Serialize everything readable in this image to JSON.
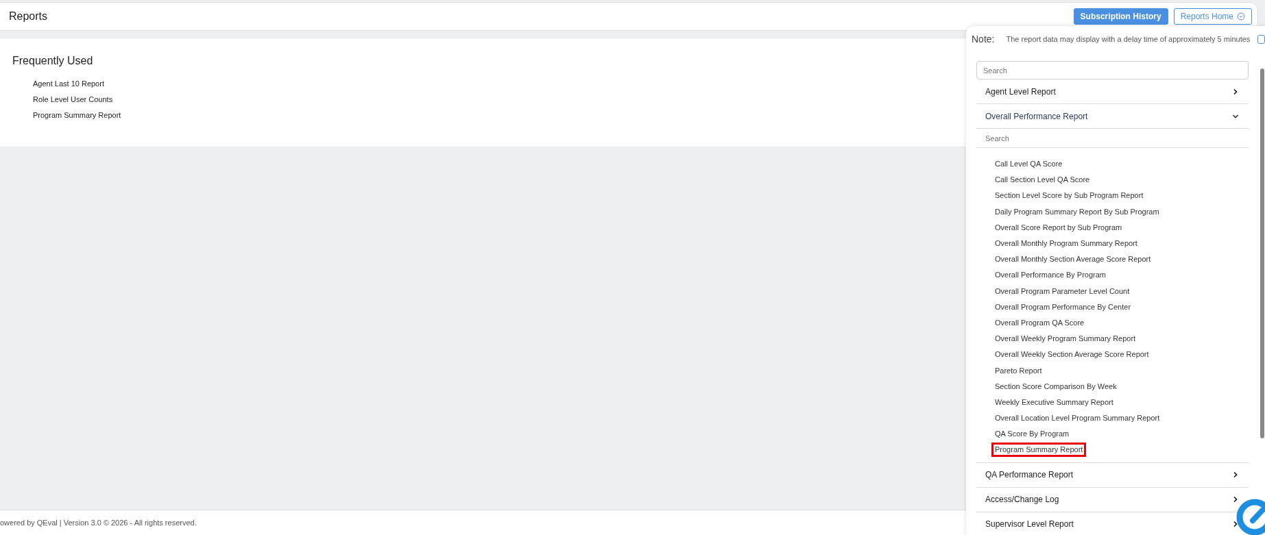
{
  "header": {
    "title": "Reports",
    "buttons": [
      {
        "label": "Subscription History",
        "kind": "primary"
      },
      {
        "label": "Reports Home",
        "kind": "outline"
      }
    ]
  },
  "frequently_used": {
    "title": "Frequently Used",
    "items": [
      "Agent Last 10 Report",
      "Role Level User Counts",
      "Program Summary Report"
    ]
  },
  "panel": {
    "note_label": "Note:",
    "note": "The report data may display with a delay time of approximately 5 minutes",
    "search": {
      "placeholder": "Search"
    },
    "categories": [
      {
        "label": "Agent Level Report",
        "expanded": false
      },
      {
        "label": "Overall Performance Report",
        "expanded": true,
        "search": {
          "placeholder": "Search"
        },
        "items": [
          {
            "label": "Call Level QA Score",
            "highlighted": false
          },
          {
            "label": "Call Section Level QA Score",
            "highlighted": false
          },
          {
            "label": "Section Level Score by Sub Program Report",
            "highlighted": false
          },
          {
            "label": "Daily Program Summary Report By Sub Program",
            "highlighted": false
          },
          {
            "label": "Overall Score Report by Sub Program",
            "highlighted": false
          },
          {
            "label": "Overall Monthly Program Summary Report",
            "highlighted": false
          },
          {
            "label": "Overall Monthly Section Average Score Report",
            "highlighted": false
          },
          {
            "label": "Overall Performance By Program",
            "highlighted": false
          },
          {
            "label": "Overall Program Parameter Level Count",
            "highlighted": false
          },
          {
            "label": "Overall Program Performance By Center",
            "highlighted": false
          },
          {
            "label": "Overall Program QA Score",
            "highlighted": false
          },
          {
            "label": "Overall Weekly Program Summary Report",
            "highlighted": false
          },
          {
            "label": "Overall Weekly Section Average Score Report",
            "highlighted": false
          },
          {
            "label": "Pareto Report",
            "highlighted": false
          },
          {
            "label": "Section Score Comparison By Week",
            "highlighted": false
          },
          {
            "label": "Weekly Executive Summary Report",
            "highlighted": false
          },
          {
            "label": "Overall Location Level Program Summary Report",
            "highlighted": false
          },
          {
            "label": "QA Score By Program",
            "highlighted": false
          },
          {
            "label": "Program Summary Report",
            "highlighted": true
          }
        ]
      },
      {
        "label": "QA Performance Report",
        "expanded": false
      },
      {
        "label": "Access/Change Log",
        "expanded": false
      },
      {
        "label": "Supervisor Level Report",
        "expanded": false
      }
    ]
  },
  "footer": {
    "text": "owered by QEval | Version 3.0 © 2026 - All rights reserved."
  }
}
